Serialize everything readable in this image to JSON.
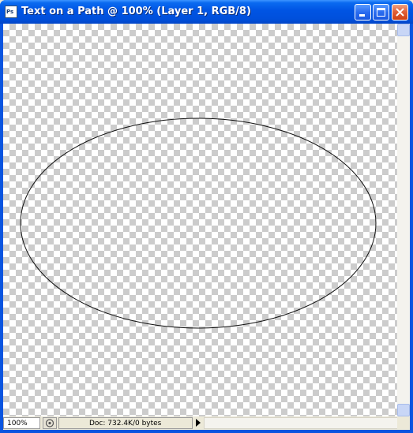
{
  "window": {
    "title": "Text on a Path @ 100% (Layer 1, RGB/8)",
    "app_icon_text": "Ps",
    "buttons": {
      "minimize": "minimize-icon",
      "maximize": "maximize-icon",
      "close": "close-icon"
    }
  },
  "canvas": {
    "background": "transparency-checkerboard",
    "shape": "ellipse-path"
  },
  "status_bar": {
    "zoom": "100%",
    "doc_info": "Doc: 732.4K/0 bytes",
    "menu_arrow": "triangle-right-icon"
  },
  "colors": {
    "titlebar": "#0054e3",
    "close_button": "#e2613a",
    "checker": "#cccccc"
  }
}
